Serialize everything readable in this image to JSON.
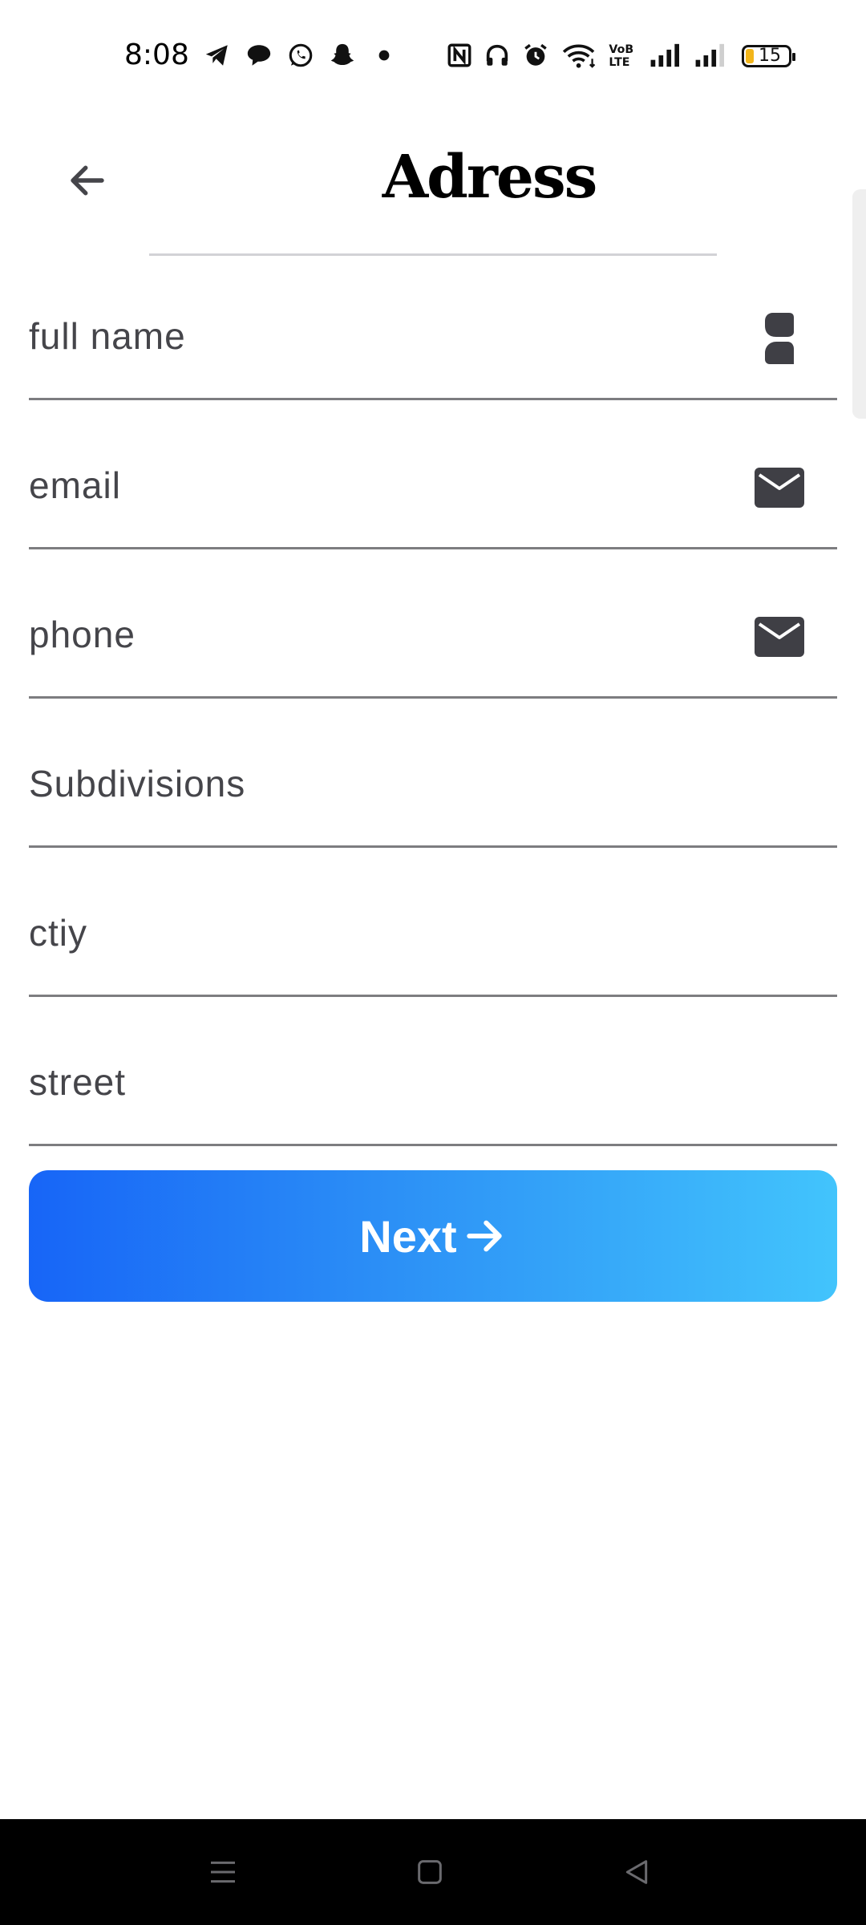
{
  "status_bar": {
    "time": "8:08",
    "battery": "15",
    "icons": [
      "telegram-icon",
      "chat-bubble-icon",
      "whatsapp-icon",
      "snapchat-icon",
      "dot-icon",
      "nfc-icon",
      "headphones-icon",
      "alarm-icon",
      "wifi-icon",
      "volte-icon",
      "signal-icon",
      "signal-icon"
    ]
  },
  "header": {
    "title": "Adress",
    "back_icon": "arrow-left-icon"
  },
  "form": {
    "fields": [
      {
        "label": "full name",
        "icon": "person-icon"
      },
      {
        "label": "email",
        "icon": "mail-icon"
      },
      {
        "label": "phone",
        "icon": "mail-icon"
      },
      {
        "label": "Subdivisions"
      },
      {
        "label": "ctiy"
      },
      {
        "label": "street"
      }
    ]
  },
  "next_button": {
    "label": "Next",
    "icon": "arrow-right-icon",
    "gradient_start": "#1765f7",
    "gradient_end": "#42c4fc"
  },
  "nav_bar": {
    "buttons": [
      "menu-icon",
      "home-icon",
      "back-triangle-icon"
    ]
  }
}
